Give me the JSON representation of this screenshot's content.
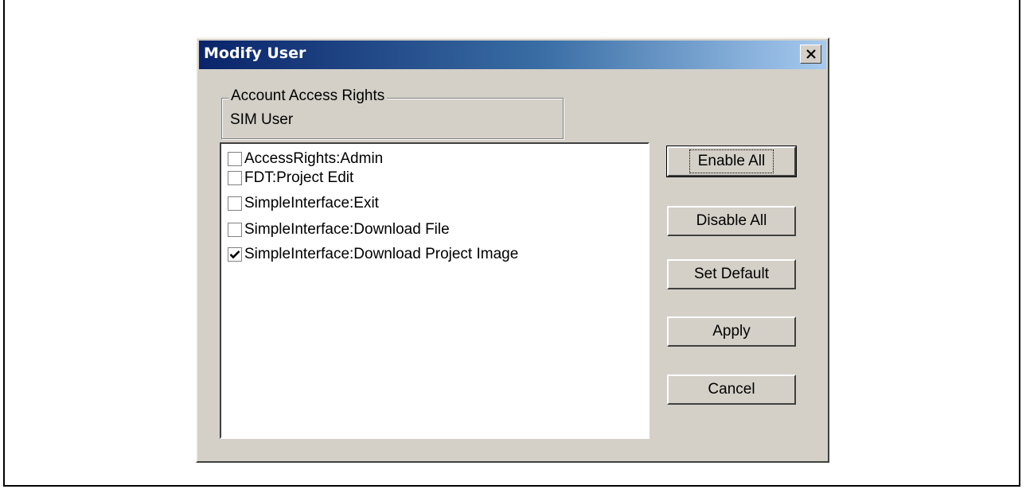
{
  "dialog": {
    "title": "Modify User",
    "close_label": "X"
  },
  "access_rights": {
    "legend": "Account Access Rights",
    "value": "SIM User"
  },
  "permissions": [
    {
      "label": "AccessRights:Admin",
      "checked": false
    },
    {
      "label": "FDT:Project Edit",
      "checked": false
    },
    {
      "label": "SimpleInterface:Exit",
      "checked": false
    },
    {
      "label": "SimpleInterface:Download File",
      "checked": false
    },
    {
      "label": "SimpleInterface:Download Project Image",
      "checked": true
    }
  ],
  "buttons": {
    "enable_all": "Enable All",
    "disable_all": "Disable All",
    "set_default": "Set Default",
    "apply": "Apply",
    "cancel": "Cancel"
  },
  "colors": {
    "dialog_bg": "#d4d0c8",
    "titlebar_start": "#0a246a",
    "titlebar_end": "#a6caf0"
  }
}
